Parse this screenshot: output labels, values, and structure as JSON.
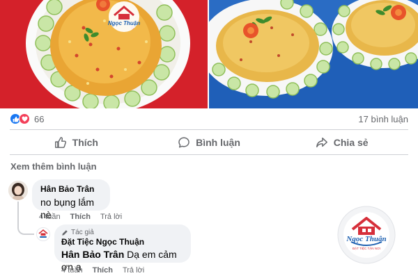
{
  "photos": {
    "left_watermark": "Ngọc Thuận",
    "right_watermark": ""
  },
  "reactions": {
    "icons": [
      "like-icon",
      "love-icon"
    ],
    "count": "66",
    "comments": "17 bình luận"
  },
  "actions": {
    "like": "Thích",
    "comment": "Bình luận",
    "share": "Chia sẻ"
  },
  "comments": {
    "view_more": "Xem thêm bình luận",
    "items": [
      {
        "author": "Hân Bảo Trân",
        "text": "no bụng lắm nè",
        "time": "4 tuần",
        "like": "Thích",
        "reply": "Trả lời"
      }
    ],
    "reply": {
      "role": "Tác giả",
      "author": "Đặt Tiệc Ngọc Thuận",
      "mention": "Hân Bảo Trân",
      "text": " Dạ em cảm ơn ạ",
      "time": "4 tuần",
      "like": "Thích",
      "reply": "Trả lời"
    }
  },
  "logo": {
    "brand": "Ngọc Thuận",
    "tagline": "ĐẶT TIỆC TẬN NƠI"
  },
  "colors": {
    "like_blue": "#1877f2",
    "love_red": "#f33e58",
    "secondary_text": "#65676b",
    "bubble": "#f0f2f5",
    "brand_red": "#d62f3a",
    "brand_blue": "#1c5fb0"
  }
}
